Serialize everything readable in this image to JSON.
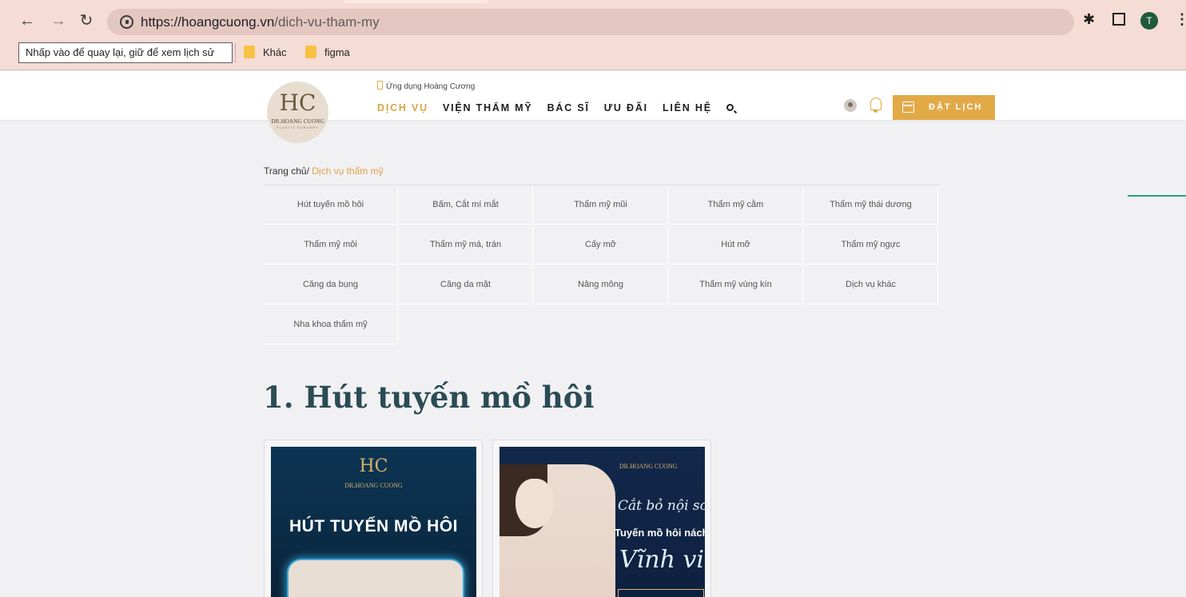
{
  "browser": {
    "url_host": "https://hoangcuong.vn",
    "url_path": "/dich-vu-tham-my",
    "back_tooltip": "Nhấp vào để quay lại, giữ để xem lịch sử",
    "avatar_letter": "T",
    "bookmarks": [
      {
        "label": "Khác"
      },
      {
        "label": "figma"
      }
    ],
    "icons": [
      "back-icon",
      "forward-icon",
      "reload-icon",
      "site-info-icon",
      "extensions-icon",
      "sidebar-icon",
      "menu-icon"
    ]
  },
  "site": {
    "logo_mark": "HC",
    "logo_text": "DR.HOANG CUONG",
    "logo_sub": "PLASTIC SURGERY",
    "app_link": "Ứng dụng Hoàng Cương",
    "nav": [
      {
        "label": "DỊCH VỤ",
        "active": true
      },
      {
        "label": "VIỆN THẨM MỸ"
      },
      {
        "label": "BÁC SĨ"
      },
      {
        "label": "ƯU ĐÃI"
      },
      {
        "label": "LIÊN HỆ"
      }
    ],
    "book_button": "ĐẶT LỊCH",
    "accent_color": "#e2a947"
  },
  "breadcrumb": {
    "home": "Trang chủ/",
    "current": "Dịch vụ thẩm mỹ"
  },
  "services": [
    "Hút tuyến mồ hôi",
    "Bấm, Cắt mí mắt",
    "Thẩm mỹ mũi",
    "Thẩm mỹ cằm",
    "Thẩm mỹ thái dương",
    "Thẩm mỹ môi",
    "Thẩm mỹ má, trán",
    "Cấy mỡ",
    "Hút mỡ",
    "Thẩm mỹ ngực",
    "Căng da bụng",
    "Căng da mặt",
    "Nâng mông",
    "Thẩm mỹ vùng kín",
    "Dịch vụ khác",
    "Nha khoa thẩm mỹ"
  ],
  "section": {
    "title": "1. Hút tuyến mồ hôi"
  },
  "cards": [
    {
      "logo_text": "DR.HOANG CUONG",
      "headline": "HÚT TUYẾN MỒ HÔI"
    },
    {
      "logo_text": "DR.HOANG CUONG",
      "script1": "Cắt bỏ nội soi",
      "line": "Tuyến mồ hôi nách",
      "script2": "Vĩnh viễn"
    }
  ]
}
